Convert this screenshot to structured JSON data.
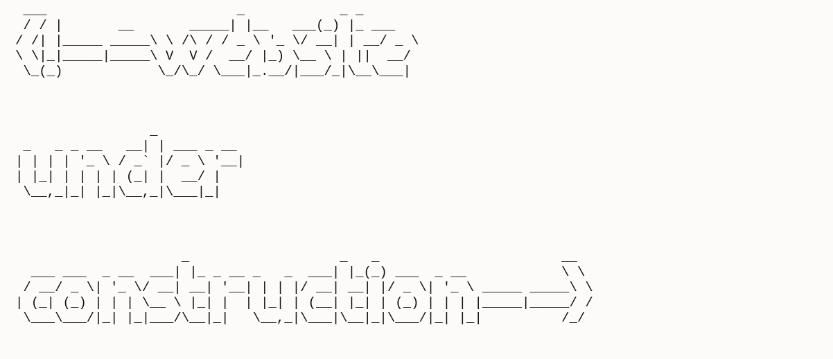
{
  "banner": {
    "website_art": " ___                        _            _ _\n / / |       __       _____| |__   ___(_) |_ ___\n/ /| |_____ _____\\ \\ /\\ / / _ \\ '_ \\/ __| | __/ _ \\\n\\ \\|_|_____|_____\\ V  V /  __/ |_) \\__ \\ | ||  __/\n \\_(_)            \\_/\\_/ \\___|_.__/|___/_|\\__\\___|",
    "under_art": "                 _\n _   _ _ __   __| | ___ _ __\n| | | | '_ \\ / _` |/ _ \\ '__|\n| |_| | | | | (_| |  __/ |\n \\__,_|_| |_|\\__,_|\\___|_|",
    "construction_art": "                     _                   _   _                       __\n  ___ ___  _ __  ___| |_ _ __ _   _  ___| |_(_) ___  _ __            \\ \\\n / __/ _ \\| '_ \\/ __| __| '__| | | |/ __| __| |/ _ \\| '_ \\ _____ _____\\ \\\n| (_| (_) | | | \\__ \\ |_| |  | |_| | (__| |_| | (_) | | | |_____|_____/ /\n \\___\\___/|_| |_|___/\\__|_|   \\__,_|\\___|\\__|_|\\___/|_| |_|          /_/"
  }
}
